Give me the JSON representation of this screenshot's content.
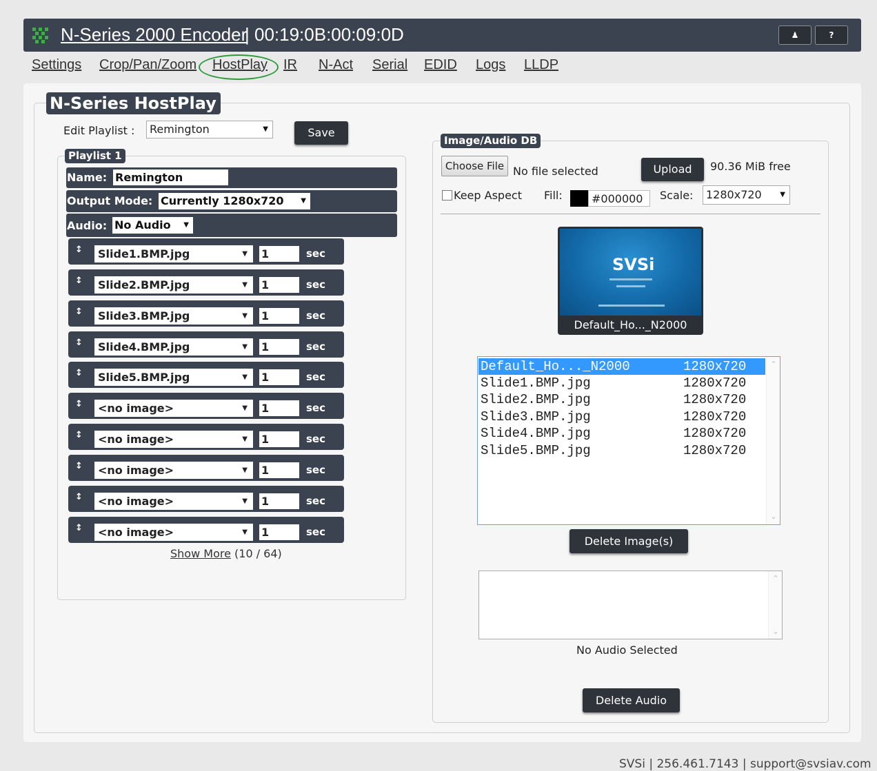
{
  "header": {
    "device_name": "N-Series 2000 Encoder",
    "mac": "| 00:19:0B:00:09:0D",
    "user_button": "♟",
    "help_button": "?"
  },
  "nav": {
    "items": [
      "Settings",
      "Crop/Pan/Zoom",
      "HostPlay",
      "IR",
      "N-Act",
      "Serial",
      "EDID",
      "Logs",
      "LLDP"
    ],
    "active": "HostPlay"
  },
  "hostplay": {
    "title": "N-Series HostPlay",
    "edit_playlist_label": "Edit Playlist :",
    "edit_playlist_value": "Remington",
    "save_label": "Save",
    "playlist_legend": "Playlist 1",
    "name_label": "Name:",
    "name_value": "Remington",
    "output_mode_label": "Output Mode:",
    "output_mode_value": "Currently 1280x720",
    "audio_label": "Audio:",
    "audio_value": "No Audio",
    "slides": [
      {
        "image": "Slide1.BMP.jpg",
        "duration": "1",
        "unit": "sec"
      },
      {
        "image": "Slide2.BMP.jpg",
        "duration": "1",
        "unit": "sec"
      },
      {
        "image": "Slide3.BMP.jpg",
        "duration": "1",
        "unit": "sec"
      },
      {
        "image": "Slide4.BMP.jpg",
        "duration": "1",
        "unit": "sec"
      },
      {
        "image": "Slide5.BMP.jpg",
        "duration": "1",
        "unit": "sec"
      },
      {
        "image": "<no image>",
        "duration": "1",
        "unit": "sec"
      },
      {
        "image": "<no image>",
        "duration": "1",
        "unit": "sec"
      },
      {
        "image": "<no image>",
        "duration": "1",
        "unit": "sec"
      },
      {
        "image": "<no image>",
        "duration": "1",
        "unit": "sec"
      },
      {
        "image": "<no image>",
        "duration": "1",
        "unit": "sec"
      }
    ],
    "show_more_label": "Show More",
    "show_more_count": "(10 / 64)"
  },
  "db": {
    "legend": "Image/Audio DB",
    "choose_file_label": "Choose File",
    "no_file_text": "No file selected",
    "upload_label": "Upload",
    "free_space": "90.36 MiB free",
    "keep_aspect_label": "Keep Aspect",
    "fill_label": "Fill:",
    "fill_color": "#000000",
    "scale_label": "Scale:",
    "scale_value": "1280x720",
    "preview_caption": "Default_Ho..._N2000",
    "preview_logo": "SVSi",
    "images": [
      {
        "name": "Default_Ho..._N2000",
        "res": "1280x720",
        "selected": true
      },
      {
        "name": "Slide1.BMP.jpg",
        "res": "1280x720",
        "selected": false
      },
      {
        "name": "Slide2.BMP.jpg",
        "res": "1280x720",
        "selected": false
      },
      {
        "name": "Slide3.BMP.jpg",
        "res": "1280x720",
        "selected": false
      },
      {
        "name": "Slide4.BMP.jpg",
        "res": "1280x720",
        "selected": false
      },
      {
        "name": "Slide5.BMP.jpg",
        "res": "1280x720",
        "selected": false
      }
    ],
    "delete_images_label": "Delete Image(s)",
    "no_audio_text": "No Audio Selected",
    "delete_audio_label": "Delete Audio"
  },
  "footer": {
    "text": "SVSi | 256.461.7143 | support@svsiav.com"
  },
  "colors": {
    "bar": "#3c4350",
    "accent_selected": "#3399ff",
    "nav_highlight": "#2e9a3c"
  }
}
